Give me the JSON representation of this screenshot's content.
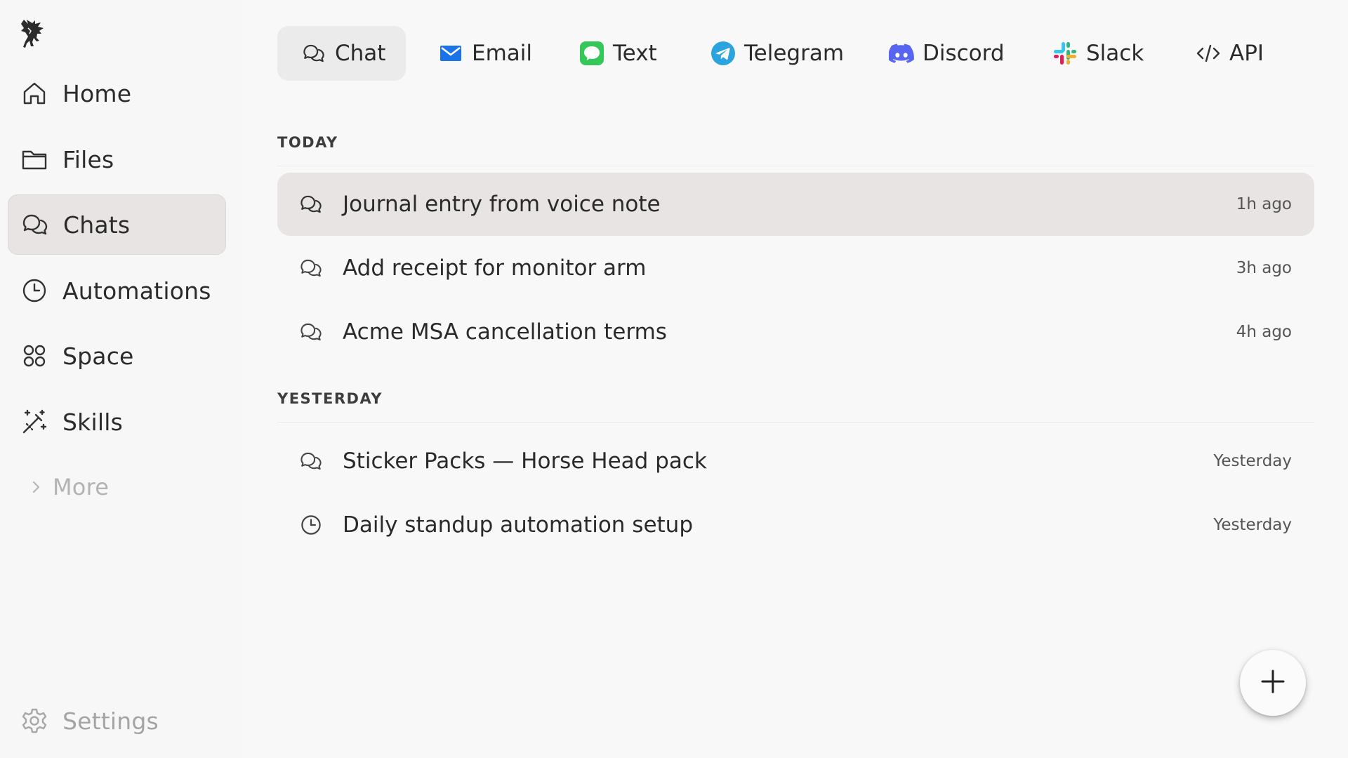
{
  "app": {
    "logo_icon": "pegasus-logo-icon"
  },
  "sidebar": {
    "items": [
      {
        "label": "Home",
        "icon": "home-icon"
      },
      {
        "label": "Files",
        "icon": "folder-icon"
      },
      {
        "label": "Chats",
        "icon": "chat-bubbles-icon",
        "active": true
      },
      {
        "label": "Automations",
        "icon": "clock-icon"
      },
      {
        "label": "Space",
        "icon": "grid-circles-icon"
      },
      {
        "label": "Skills",
        "icon": "magic-wand-icon"
      }
    ],
    "more_label": "More",
    "settings_label": "Settings"
  },
  "channels": {
    "tabs": [
      {
        "label": "Chat",
        "icon": "chat-bubbles-icon",
        "active": true
      },
      {
        "label": "Email",
        "icon": "email-icon",
        "color": "#1a73e8"
      },
      {
        "label": "Text",
        "icon": "imessage-icon",
        "color": "#34c759"
      },
      {
        "label": "Telegram",
        "icon": "telegram-icon",
        "color": "#2aa3df"
      },
      {
        "label": "Discord",
        "icon": "discord-icon",
        "color": "#5865f2"
      },
      {
        "label": "Slack",
        "icon": "slack-icon"
      },
      {
        "label": "API",
        "icon": "code-icon"
      }
    ]
  },
  "sections": {
    "today_label": "TODAY",
    "yesterday_label": "YESTERDAY"
  },
  "chats": {
    "today": [
      {
        "title": "Journal entry from voice note",
        "time": "1h ago",
        "icon": "chat-bubbles-icon",
        "active": true
      },
      {
        "title": "Add receipt for monitor arm",
        "time": "3h ago",
        "icon": "chat-bubbles-icon"
      },
      {
        "title": "Acme MSA cancellation terms",
        "time": "4h ago",
        "icon": "chat-bubbles-icon"
      }
    ],
    "yesterday": [
      {
        "title": "Sticker Packs — Horse Head pack",
        "time": "Yesterday",
        "icon": "chat-bubbles-icon"
      },
      {
        "title": "Daily standup automation setup",
        "time": "Yesterday",
        "icon": "clock-icon"
      }
    ]
  },
  "fab": {
    "icon": "plus-icon"
  }
}
